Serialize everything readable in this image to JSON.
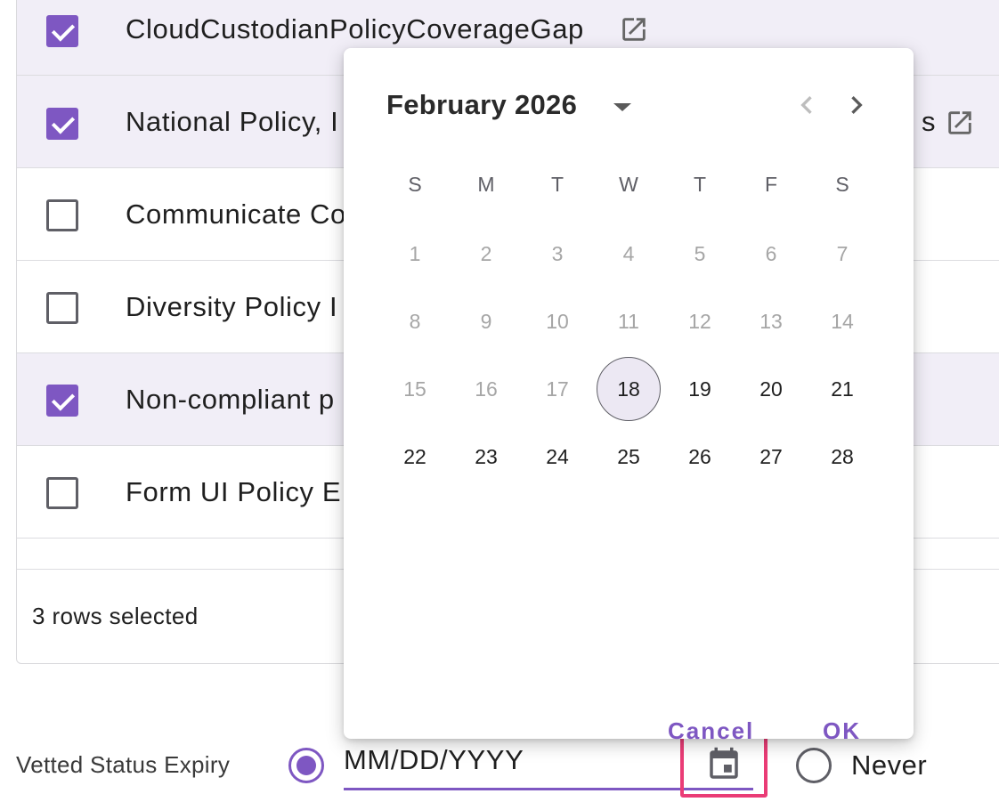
{
  "table": {
    "rows": [
      {
        "label": "CloudCustodianPolicyCoverageGap",
        "checked": true,
        "has_link": true
      },
      {
        "label": "National Policy, I",
        "trailing": "s",
        "checked": true,
        "has_link": true
      },
      {
        "label": "Communicate Co",
        "checked": false,
        "has_link": false
      },
      {
        "label": "Diversity Policy I",
        "checked": false,
        "has_link": false
      },
      {
        "label": "Non-compliant p",
        "checked": true,
        "has_link": false
      },
      {
        "label": "Form UI Policy E",
        "checked": false,
        "has_link": false
      }
    ],
    "footer": {
      "selection_text": "3 rows selected"
    },
    "icons": {
      "open_in_new": "open-in-new-icon"
    }
  },
  "form": {
    "vetted_label": "Vetted Status Expiry",
    "date_option_selected": true,
    "date_input": {
      "value": "",
      "placeholder": "MM/DD/YYYY"
    },
    "calendar_icon": "calendar-icon",
    "never_label": "Never",
    "never_selected": false,
    "accent_color": "#7e57c2",
    "highlight_color": "#ea3c76"
  },
  "picker": {
    "month_label": "February 2026",
    "weekdays": [
      "S",
      "M",
      "T",
      "W",
      "T",
      "F",
      "S"
    ],
    "weeks": [
      [
        1,
        2,
        3,
        4,
        5,
        6,
        7
      ],
      [
        8,
        9,
        10,
        11,
        12,
        13,
        14
      ],
      [
        15,
        16,
        17,
        18,
        19,
        20,
        21
      ],
      [
        22,
        23,
        24,
        25,
        26,
        27,
        28
      ]
    ],
    "today": 18,
    "first_enabled_day": 18,
    "cancel_label": "Cancel",
    "ok_label": "OK"
  }
}
